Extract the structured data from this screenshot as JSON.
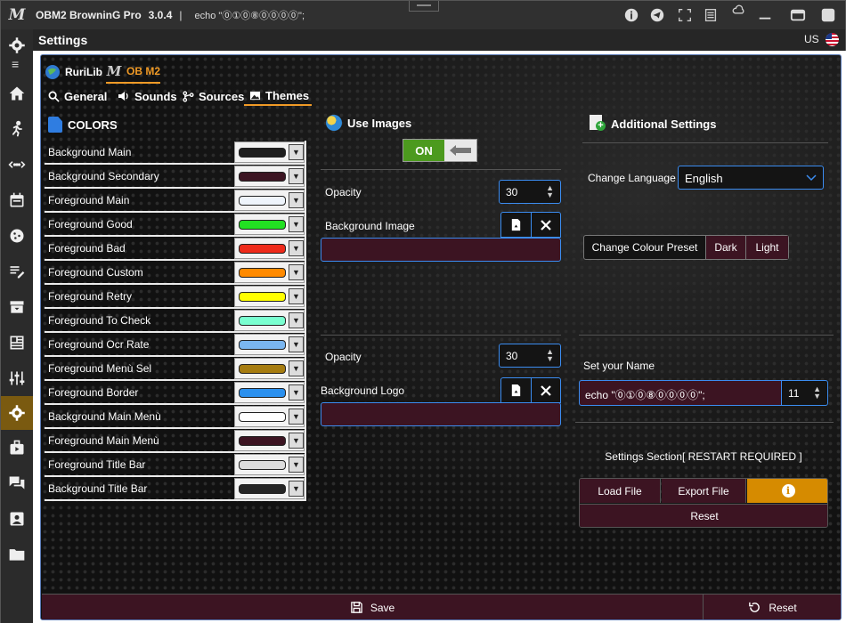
{
  "window": {
    "logo": "M",
    "app_name": "OBM2 BrowninG Pro",
    "version": "3.0.4",
    "separator": "|",
    "echo_text": "echo \"⓪①⓪⑧⓪⓪⓪⓪\";",
    "icons": [
      "info-icon",
      "telegram-icon",
      "fullscreen-icon",
      "notes-icon",
      "cloud-icon",
      "minimize-icon",
      "maximize-icon",
      "close-icon"
    ]
  },
  "header": {
    "title": "Settings",
    "language_code": "US"
  },
  "sidebar": {
    "menu_glyph": "≡",
    "items": [
      {
        "icon": "settings-gear-icon"
      },
      {
        "icon": "home-icon"
      },
      {
        "icon": "runner-icon"
      },
      {
        "icon": "proxy-icon"
      },
      {
        "icon": "calendar-icon"
      },
      {
        "icon": "cookie-icon"
      },
      {
        "icon": "editor-icon"
      },
      {
        "icon": "archive-icon"
      },
      {
        "icon": "dashboard-icon"
      },
      {
        "icon": "equalizer-icon"
      },
      {
        "icon": "settings-icon",
        "active": true
      },
      {
        "icon": "plugin-icon"
      },
      {
        "icon": "chat-icon"
      },
      {
        "icon": "profile-icon"
      },
      {
        "icon": "folder-icon"
      }
    ]
  },
  "top_tabs": [
    {
      "label": "RuriLib",
      "active": false
    },
    {
      "label": "OB M2",
      "active": true
    }
  ],
  "sub_tabs": [
    {
      "label": "General",
      "icon": "search-icon"
    },
    {
      "label": "Sounds",
      "icon": "speaker-icon"
    },
    {
      "label": "Sources",
      "icon": "branch-icon"
    },
    {
      "label": "Themes",
      "icon": "image-icon",
      "active": true
    }
  ],
  "colors": {
    "heading": "COLORS",
    "items": [
      {
        "label": "Background Main",
        "color": "#1e1e1e"
      },
      {
        "label": "Background Secondary",
        "color": "#3c1422"
      },
      {
        "label": "Foreground Main",
        "color": "#eef4fb"
      },
      {
        "label": "Foreground Good",
        "color": "#22e022"
      },
      {
        "label": "Foreground Bad",
        "color": "#ee2a1a"
      },
      {
        "label": "Foreground Custom",
        "color": "#ff8a00"
      },
      {
        "label": "Foreground Retry",
        "color": "#ffff00"
      },
      {
        "label": "Foreground To Check",
        "color": "#7affd0"
      },
      {
        "label": "Foreground Ocr Rate",
        "color": "#7ab6f0"
      },
      {
        "label": "Foreground Menù Sel",
        "color": "#a67c10"
      },
      {
        "label": "Foreground Border",
        "color": "#2b90ee"
      },
      {
        "label": "Background Main Menù",
        "color": "#ffffff"
      },
      {
        "label": "Foreground Main Menù",
        "color": "#3c1422"
      },
      {
        "label": "Foreground Title Bar",
        "color": "#dcdcdc"
      },
      {
        "label": "Background Title Bar",
        "color": "#252525"
      }
    ]
  },
  "images": {
    "heading": "Use Images",
    "toggle_label": "ON",
    "opacity_label": "Opacity",
    "bg_opacity": "30",
    "bg_image_label": "Background Image",
    "bg_image_path": "",
    "logo_opacity": "30",
    "bg_logo_label": "Background Logo",
    "bg_logo_path": ""
  },
  "additional": {
    "heading": "Additional Settings",
    "language_label": "Change Language",
    "language_value": "English",
    "preset_label": "Change Colour Preset",
    "preset_dark": "Dark",
    "preset_light": "Light",
    "name_label": "Set your Name",
    "name_value": "echo \"⓪①⓪⑧⓪⓪⓪⓪\";",
    "name_size": "11",
    "section_title": "Settings Section[ RESTART REQUIRED ]",
    "load_file": "Load File",
    "export_file": "Export File",
    "info_glyph": "i",
    "reset": "Reset"
  },
  "footer": {
    "save": "Save",
    "reset": "Reset"
  }
}
